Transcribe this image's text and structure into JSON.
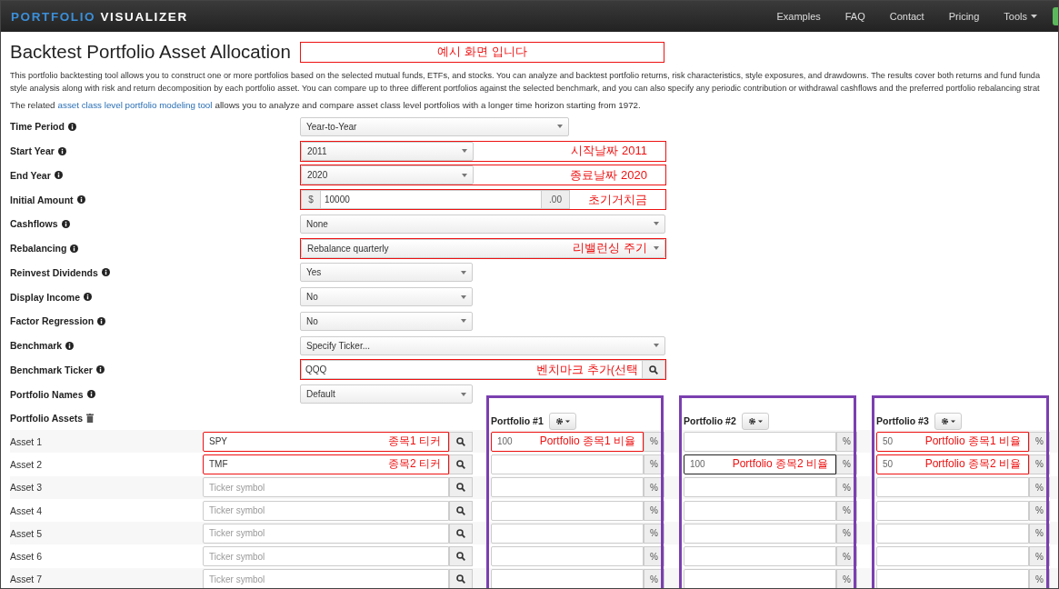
{
  "navbar": {
    "brand_first": "PORTFOLIO",
    "brand_second": "VISUALIZER",
    "links": [
      {
        "label": "Examples",
        "dropdown": false
      },
      {
        "label": "FAQ",
        "dropdown": false
      },
      {
        "label": "Contact",
        "dropdown": false
      },
      {
        "label": "Pricing",
        "dropdown": false
      },
      {
        "label": "Tools",
        "dropdown": true
      }
    ]
  },
  "title": "Backtest Portfolio Asset Allocation",
  "title_note": "예시 화면 입니다",
  "intro_lines": [
    "This portfolio backtesting tool allows you to construct one or more portfolios based on the selected mutual funds, ETFs, and stocks. You can analyze and backtest portfolio returns, risk characteristics, style exposures, and drawdowns. The results cover both returns and fund funda",
    "style analysis along with risk and return decomposition by each portfolio asset. You can compare up to three different portfolios against the selected benchmark, and you can also specify any periodic contribution or withdrawal cashflows and the preferred portfolio rebalancing strat"
  ],
  "related": {
    "before": "The related",
    "link": "asset class level portfolio modeling tool",
    "after": "allows you to analyze and compare asset class level portfolios with a longer time horizon starting from 1972."
  },
  "fields": [
    {
      "label": "Time Period",
      "kind": "select",
      "value": "Year-to-Year"
    },
    {
      "label": "Start Year",
      "kind": "select",
      "value": "2011",
      "note": "시작날짜 2011"
    },
    {
      "label": "End Year",
      "kind": "select",
      "value": "2020",
      "note": "종료날짜 2020"
    },
    {
      "label": "Initial Amount",
      "kind": "money",
      "prefix": "$",
      "value": "10000",
      "suffix": ".00",
      "note": "초기거치금"
    },
    {
      "label": "Cashflows",
      "kind": "select",
      "value": "None"
    },
    {
      "label": "Rebalancing",
      "kind": "select",
      "value": "Rebalance quarterly",
      "note": "리밸런싱 주기"
    },
    {
      "label": "Reinvest Dividends",
      "kind": "select",
      "value": "Yes"
    },
    {
      "label": "Display Income",
      "kind": "select",
      "value": "No"
    },
    {
      "label": "Factor Regression",
      "kind": "select",
      "value": "No"
    },
    {
      "label": "Benchmark",
      "kind": "select",
      "value": "Specify Ticker..."
    },
    {
      "label": "Benchmark Ticker",
      "kind": "ticker",
      "value": "QQQ",
      "note": "벤치마크 추가(선택"
    },
    {
      "label": "Portfolio Names",
      "kind": "select",
      "value": "Default"
    }
  ],
  "assets_label": "Portfolio Assets",
  "assets": [
    {
      "label": "Asset 1",
      "ticker": "SPY",
      "note": "종목1 티커"
    },
    {
      "label": "Asset 2",
      "ticker": "TMF",
      "note": "종목2 티커"
    },
    {
      "label": "Asset 3",
      "placeholder": "Ticker symbol"
    },
    {
      "label": "Asset 4",
      "placeholder": "Ticker symbol"
    },
    {
      "label": "Asset 5",
      "placeholder": "Ticker symbol"
    },
    {
      "label": "Asset 6",
      "placeholder": "Ticker symbol"
    },
    {
      "label": "Asset 7",
      "placeholder": "Ticker symbol"
    }
  ],
  "portfolios": [
    {
      "title": "Portfolio #1",
      "framed": true,
      "cells": [
        {
          "value": "100",
          "note": "Portfolio 종목1 비율",
          "color": "#ee1111"
        },
        {},
        {},
        {},
        {},
        {},
        {}
      ]
    },
    {
      "title": "Portfolio #2",
      "framed": true,
      "cells": [
        {},
        {
          "value": "100",
          "note": "Portfolio 종목2 비율",
          "color": "#222222"
        },
        {},
        {},
        {},
        {},
        {}
      ]
    },
    {
      "title": "Portfolio #3",
      "framed": true,
      "cells": [
        {
          "value": "50",
          "note": "Portfolio 종목1 비율",
          "color": "#ee1111"
        },
        {
          "value": "50",
          "note": "Portfolio 종목2 비율",
          "color": "#ee1111"
        },
        {},
        {},
        {},
        {},
        {}
      ]
    }
  ],
  "percent_sign": "%"
}
